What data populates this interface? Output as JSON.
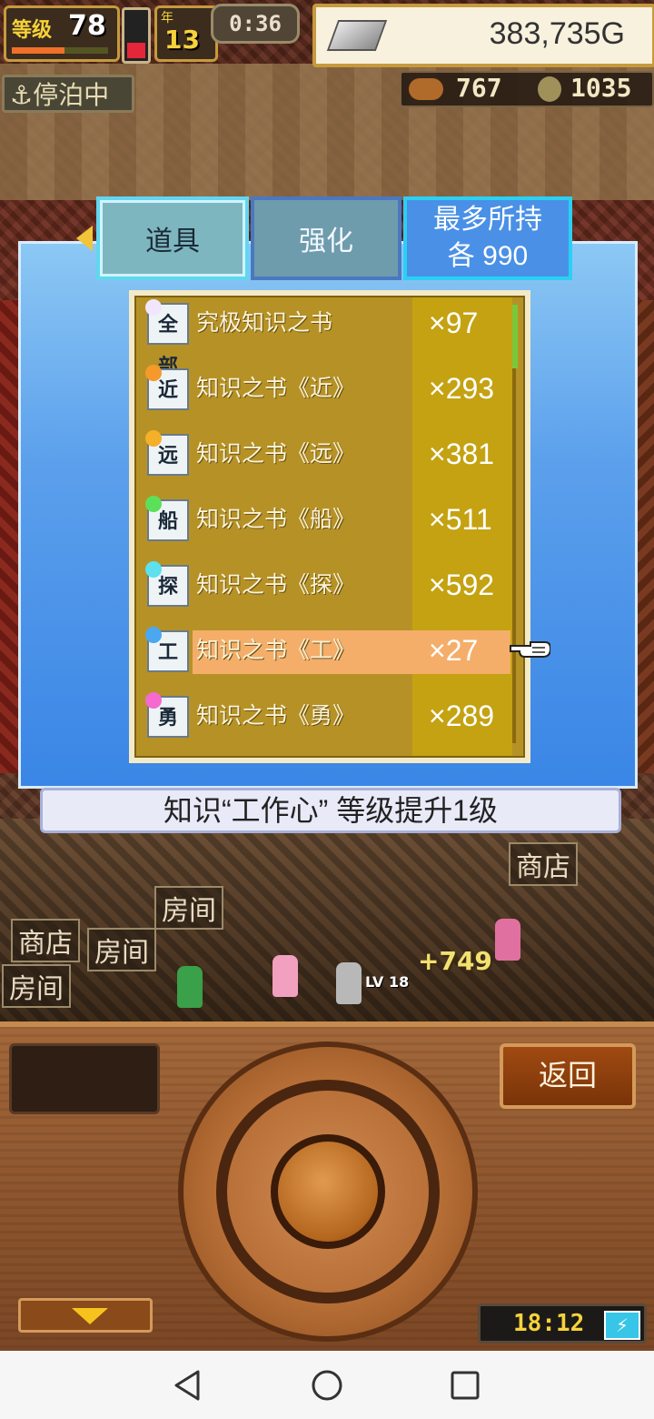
{
  "hud": {
    "level_tag": "等级",
    "level": "78",
    "xp_progress": 0.55,
    "battery_level": 0.3,
    "year_label": "年",
    "year": "13",
    "timer": "0:36",
    "gold": "383,735G",
    "dock_status": "⚓停泊中",
    "food": "767",
    "wood": "1035"
  },
  "tabs": {
    "items_label": "道具",
    "upgrade_label": "强化",
    "max_hold_title": "最多所持",
    "max_hold_value": "各 990"
  },
  "items": [
    {
      "icon_text": "全部",
      "gem_color": "#f2e6ff",
      "name": "究极知识之书",
      "qty": "×97"
    },
    {
      "icon_text": "近",
      "gem_color": "#f59a2a",
      "name": "知识之书《近》",
      "qty": "×293"
    },
    {
      "icon_text": "远",
      "gem_color": "#f5b02a",
      "name": "知识之书《远》",
      "qty": "×381"
    },
    {
      "icon_text": "船",
      "gem_color": "#5ce05a",
      "name": "知识之书《船》",
      "qty": "×511"
    },
    {
      "icon_text": "探",
      "gem_color": "#5ee0ee",
      "name": "知识之书《探》",
      "qty": "×592"
    },
    {
      "icon_text": "工",
      "gem_color": "#4aa8f0",
      "name": "知识之书《工》",
      "qty": "×27",
      "selected": true
    },
    {
      "icon_text": "勇",
      "gem_color": "#f56ad0",
      "name": "知识之书《勇》",
      "qty": "×289"
    }
  ],
  "description": "知识“工作心” 等级提升1级",
  "controls": {
    "back_label": "返回",
    "clock": "18:12",
    "charging_icon": "⚡"
  },
  "scene": {
    "room_labels": [
      "房间",
      "房间",
      "房间",
      "商店",
      "商店"
    ],
    "popup_value": "+749",
    "unit_level": "LV 18"
  },
  "colors": {
    "panel_blue": "#3a86e6",
    "list_gold": "#b69226",
    "selected_row": "#f4ae6a",
    "gold_text": "#333333"
  }
}
